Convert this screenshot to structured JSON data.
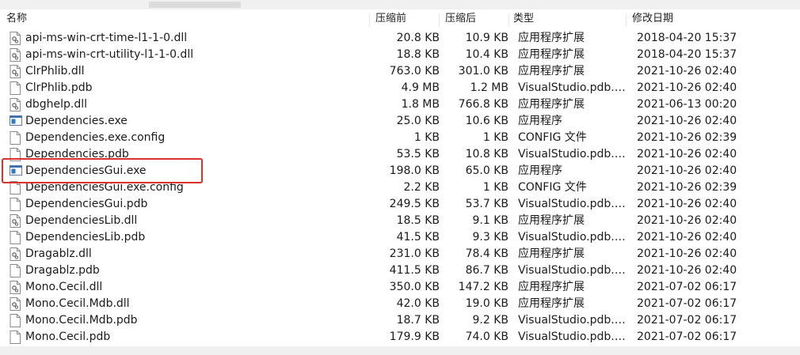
{
  "columns": {
    "name": "名称",
    "compressed": "压缩前",
    "packed": "压缩后",
    "type": "类型",
    "modified": "修改日期"
  },
  "files": [
    {
      "name": "api-ms-win-crt-time-l1-1-0.dll",
      "compressed": "20.8 KB",
      "packed": "10.9 KB",
      "type": "应用程序扩展",
      "modified": "2018-04-20 15:37",
      "icon": "dll-icon"
    },
    {
      "name": "api-ms-win-crt-utility-l1-1-0.dll",
      "compressed": "18.8 KB",
      "packed": "10.4 KB",
      "type": "应用程序扩展",
      "modified": "2018-04-20 15:37",
      "icon": "dll-icon"
    },
    {
      "name": "ClrPhlib.dll",
      "compressed": "763.0 KB",
      "packed": "301.0 KB",
      "type": "应用程序扩展",
      "modified": "2021-10-26 02:40",
      "icon": "dll-icon"
    },
    {
      "name": "ClrPhlib.pdb",
      "compressed": "4.9 MB",
      "packed": "1.2 MB",
      "type": "VisualStudio.pdb.d...",
      "modified": "2021-10-26 02:40",
      "icon": "file-icon"
    },
    {
      "name": "dbghelp.dll",
      "compressed": "1.8 MB",
      "packed": "766.8 KB",
      "type": "应用程序扩展",
      "modified": "2021-06-13 00:20",
      "icon": "dll-icon"
    },
    {
      "name": "Dependencies.exe",
      "compressed": "25.0 KB",
      "packed": "10.6 KB",
      "type": "应用程序",
      "modified": "2021-10-26 02:40",
      "icon": "exe-icon"
    },
    {
      "name": "Dependencies.exe.config",
      "compressed": "1 KB",
      "packed": "1 KB",
      "type": "CONFIG 文件",
      "modified": "2021-10-26 02:39",
      "icon": "file-icon"
    },
    {
      "name": "Dependencies.pdb",
      "compressed": "53.5 KB",
      "packed": "10.8 KB",
      "type": "VisualStudio.pdb.d...",
      "modified": "2021-10-26 02:40",
      "icon": "file-icon"
    },
    {
      "name": "DependenciesGui.exe",
      "compressed": "198.0 KB",
      "packed": "65.0 KB",
      "type": "应用程序",
      "modified": "2021-10-26 02:40",
      "icon": "exe-icon"
    },
    {
      "name": "DependenciesGui.exe.config",
      "compressed": "2.2 KB",
      "packed": "1 KB",
      "type": "CONFIG 文件",
      "modified": "2021-10-26 02:39",
      "icon": "file-icon"
    },
    {
      "name": "DependenciesGui.pdb",
      "compressed": "249.5 KB",
      "packed": "53.7 KB",
      "type": "VisualStudio.pdb.d...",
      "modified": "2021-10-26 02:40",
      "icon": "file-icon"
    },
    {
      "name": "DependenciesLib.dll",
      "compressed": "18.5 KB",
      "packed": "9.1 KB",
      "type": "应用程序扩展",
      "modified": "2021-10-26 02:40",
      "icon": "dll-icon"
    },
    {
      "name": "DependenciesLib.pdb",
      "compressed": "41.5 KB",
      "packed": "9.3 KB",
      "type": "VisualStudio.pdb.d...",
      "modified": "2021-10-26 02:40",
      "icon": "file-icon"
    },
    {
      "name": "Dragablz.dll",
      "compressed": "231.0 KB",
      "packed": "78.4 KB",
      "type": "应用程序扩展",
      "modified": "2021-10-26 02:40",
      "icon": "dll-icon"
    },
    {
      "name": "Dragablz.pdb",
      "compressed": "411.5 KB",
      "packed": "86.7 KB",
      "type": "VisualStudio.pdb.d...",
      "modified": "2021-10-26 02:40",
      "icon": "file-icon"
    },
    {
      "name": "Mono.Cecil.dll",
      "compressed": "350.0 KB",
      "packed": "147.2 KB",
      "type": "应用程序扩展",
      "modified": "2021-07-02 06:17",
      "icon": "dll-icon"
    },
    {
      "name": "Mono.Cecil.Mdb.dll",
      "compressed": "42.0 KB",
      "packed": "19.0 KB",
      "type": "应用程序扩展",
      "modified": "2021-07-02 06:17",
      "icon": "dll-icon"
    },
    {
      "name": "Mono.Cecil.Mdb.pdb",
      "compressed": "18.7 KB",
      "packed": "9.2 KB",
      "type": "VisualStudio.pdb.d...",
      "modified": "2021-07-02 06:17",
      "icon": "file-icon"
    },
    {
      "name": "Mono.Cecil.pdb",
      "compressed": "179.9 KB",
      "packed": "74.0 KB",
      "type": "VisualStudio.pdb.d...",
      "modified": "2021-07-02 06:17",
      "icon": "file-icon"
    }
  ],
  "highlight_color": "#d9322b"
}
